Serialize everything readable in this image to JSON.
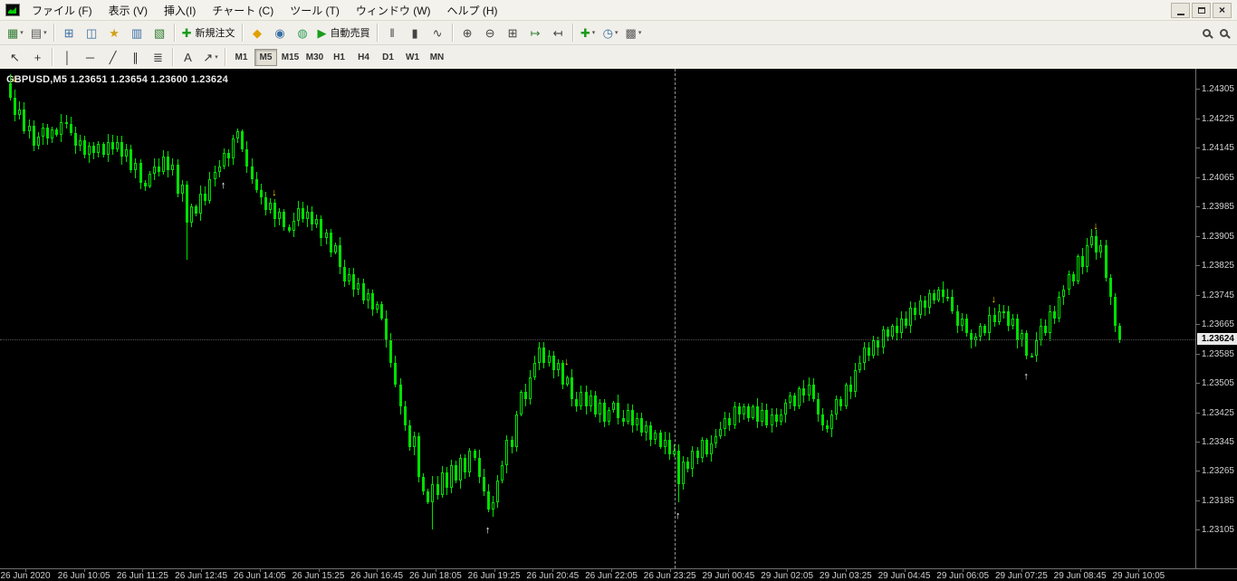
{
  "menu": {
    "items": [
      "ファイル (F)",
      "表示 (V)",
      "挿入(I)",
      "チャート (C)",
      "ツール (T)",
      "ウィンドウ (W)",
      "ヘルプ (H)"
    ],
    "item_names": [
      "file",
      "view",
      "insert",
      "charts",
      "tools",
      "window",
      "help"
    ]
  },
  "window": {
    "controls": [
      "minimize",
      "restore",
      "close"
    ]
  },
  "toolbar_main": {
    "items": [
      {
        "t": "btn",
        "name": "new-chart",
        "glyph": "▦",
        "color": "#2e7d32",
        "drop": true
      },
      {
        "t": "btn",
        "name": "profiles",
        "glyph": "▤",
        "color": "#5a5a5a",
        "drop": true
      },
      {
        "t": "sep"
      },
      {
        "t": "btn",
        "name": "market-watch",
        "glyph": "⊞",
        "color": "#3a6ea5"
      },
      {
        "t": "btn",
        "name": "data-window",
        "glyph": "◫",
        "color": "#3a6ea5"
      },
      {
        "t": "btn",
        "name": "navigator",
        "glyph": "★",
        "color": "#d4a017"
      },
      {
        "t": "btn",
        "name": "terminal",
        "glyph": "▥",
        "color": "#3a6ea5"
      },
      {
        "t": "btn",
        "name": "strategy-tester",
        "glyph": "▧",
        "color": "#2e7d32"
      },
      {
        "t": "sep"
      },
      {
        "t": "btn",
        "name": "new-order",
        "glyph": "✚",
        "color": "#1a9c1a",
        "label": "新規注文"
      },
      {
        "t": "sep"
      },
      {
        "t": "btn",
        "name": "metaeditor",
        "glyph": "◆",
        "color": "#e0a000"
      },
      {
        "t": "btn",
        "name": "experts",
        "glyph": "◉",
        "color": "#3a6ea5"
      },
      {
        "t": "btn",
        "name": "mql5-community",
        "glyph": "◍",
        "color": "#2e9e5b"
      },
      {
        "t": "btn",
        "name": "auto-trading",
        "glyph": "▶",
        "color": "#1a9c1a",
        "label": "自動売買"
      },
      {
        "t": "sep"
      },
      {
        "t": "btn",
        "name": "chart-bars",
        "glyph": "‖",
        "color": "#444"
      },
      {
        "t": "btn",
        "name": "chart-candlesticks",
        "glyph": "▮",
        "color": "#444"
      },
      {
        "t": "btn",
        "name": "chart-line",
        "glyph": "∿",
        "color": "#444"
      },
      {
        "t": "sep"
      },
      {
        "t": "btn",
        "name": "zoom-in",
        "glyph": "⊕",
        "color": "#444"
      },
      {
        "t": "btn",
        "name": "zoom-out",
        "glyph": "⊖",
        "color": "#444"
      },
      {
        "t": "btn",
        "name": "tile-windows",
        "glyph": "⊞",
        "color": "#444"
      },
      {
        "t": "btn",
        "name": "auto-scroll",
        "glyph": "↦",
        "color": "#2e7d32"
      },
      {
        "t": "btn",
        "name": "chart-shift",
        "glyph": "↤",
        "color": "#444"
      },
      {
        "t": "sep"
      },
      {
        "t": "btn",
        "name": "indicators",
        "glyph": "✚",
        "color": "#1a9c1a",
        "drop": true
      },
      {
        "t": "btn",
        "name": "periods",
        "glyph": "◷",
        "color": "#3a6ea5",
        "drop": true
      },
      {
        "t": "btn",
        "name": "templates",
        "glyph": "▩",
        "color": "#5a5a5a",
        "drop": true
      }
    ]
  },
  "toolbar_draw": {
    "items": [
      {
        "t": "btn",
        "name": "cursor",
        "glyph": "↖",
        "color": "#333"
      },
      {
        "t": "btn",
        "name": "crosshair",
        "glyph": "+",
        "color": "#333"
      },
      {
        "t": "sep"
      },
      {
        "t": "btn",
        "name": "vertical-line",
        "glyph": "│",
        "color": "#333"
      },
      {
        "t": "btn",
        "name": "horizontal-line",
        "glyph": "─",
        "color": "#333"
      },
      {
        "t": "btn",
        "name": "trendline",
        "glyph": "╱",
        "color": "#333"
      },
      {
        "t": "btn",
        "name": "equidistant-channel",
        "glyph": "∥",
        "color": "#333"
      },
      {
        "t": "btn",
        "name": "fibonacci-retracement",
        "glyph": "≣",
        "color": "#333"
      },
      {
        "t": "sep"
      },
      {
        "t": "btn",
        "name": "text-label",
        "glyph": "A",
        "color": "#333"
      },
      {
        "t": "btn",
        "name": "arrows-tool",
        "glyph": "↗",
        "color": "#333",
        "drop": true
      },
      {
        "t": "sep"
      }
    ]
  },
  "timeframes": {
    "items": [
      "M1",
      "M5",
      "M15",
      "M30",
      "H1",
      "H4",
      "D1",
      "W1",
      "MN"
    ],
    "active": "M5"
  },
  "chart_data": {
    "type": "candlestick",
    "symbol": "GBPUSD,M5",
    "ohlc_text": "1.23651 1.23654 1.23600 1.23624",
    "ylim": [
      1.23,
      1.2436
    ],
    "price_axis_labels": [
      "1.24305",
      "1.24225",
      "1.24145",
      "1.24065",
      "1.23985",
      "1.23905",
      "1.23825",
      "1.23745",
      "1.23665",
      "1.23585",
      "1.23505",
      "1.23425",
      "1.23345",
      "1.23265",
      "1.23185",
      "1.23105"
    ],
    "current_price": "1.23624",
    "time_axis_labels": [
      "26 Jun 2020",
      "26 Jun 10:05",
      "26 Jun 11:25",
      "26 Jun 12:45",
      "26 Jun 14:05",
      "26 Jun 15:25",
      "26 Jun 16:45",
      "26 Jun 18:05",
      "26 Jun 19:25",
      "26 Jun 20:45",
      "26 Jun 22:05",
      "26 Jun 23:25",
      "29 Jun 00:45",
      "29 Jun 02:05",
      "29 Jun 03:25",
      "29 Jun 04:45",
      "29 Jun 06:05",
      "29 Jun 07:25",
      "29 Jun 08:45",
      "29 Jun 10:05"
    ],
    "separator_bar": 143.5,
    "first_open": 1.2432,
    "closes": [
      1.2428,
      1.24235,
      1.2425,
      1.2419,
      1.24205,
      1.2415,
      1.24175,
      1.242,
      1.2417,
      1.24195,
      1.2418,
      1.24215,
      1.2421,
      1.24185,
      1.2415,
      1.24165,
      1.24125,
      1.2415,
      1.2413,
      1.24155,
      1.24125,
      1.2416,
      1.2414,
      1.2416,
      1.2412,
      1.2414,
      1.24085,
      1.24105,
      1.2405,
      1.2404,
      1.24075,
      1.24095,
      1.2408,
      1.2412,
      1.24085,
      1.241,
      1.2402,
      1.24045,
      1.2394,
      1.23985,
      1.23965,
      1.2402,
      1.24,
      1.2406,
      1.2408,
      1.24095,
      1.2413,
      1.24115,
      1.2417,
      1.2419,
      1.2414,
      1.24095,
      1.2406,
      1.2403,
      1.2401,
      1.23975,
      1.23995,
      1.2395,
      1.2397,
      1.2393,
      1.2392,
      1.23945,
      1.2398,
      1.2395,
      1.2397,
      1.23935,
      1.2395,
      1.239,
      1.23915,
      1.2386,
      1.2388,
      1.2382,
      1.2378,
      1.238,
      1.2376,
      1.23775,
      1.2373,
      1.2375,
      1.23705,
      1.2372,
      1.2368,
      1.2362,
      1.2356,
      1.235,
      1.2344,
      1.2339,
      1.2333,
      1.2336,
      1.2325,
      1.2321,
      1.2318,
      1.2323,
      1.232,
      1.2326,
      1.2322,
      1.2328,
      1.2324,
      1.233,
      1.2326,
      1.2332,
      1.233,
      1.2325,
      1.2321,
      1.2316,
      1.2318,
      1.2324,
      1.2328,
      1.2335,
      1.2333,
      1.2342,
      1.2348,
      1.2346,
      1.2352,
      1.2356,
      1.236,
      1.2356,
      1.2358,
      1.2354,
      1.2356,
      1.235,
      1.2352,
      1.2346,
      1.2344,
      1.2348,
      1.2344,
      1.2347,
      1.2342,
      1.2345,
      1.234,
      1.2343,
      1.2345,
      1.2341,
      1.234,
      1.2343,
      1.2339,
      1.2341,
      1.2337,
      1.2339,
      1.2335,
      1.2337,
      1.2333,
      1.2335,
      1.2331,
      1.2332,
      1.2323,
      1.2329,
      1.2327,
      1.2332,
      1.233,
      1.2335,
      1.2331,
      1.2334,
      1.2336,
      1.2338,
      1.2341,
      1.2339,
      1.2344,
      1.2342,
      1.2344,
      1.2341,
      1.2344,
      1.234,
      1.2343,
      1.2339,
      1.2342,
      1.234,
      1.2342,
      1.2345,
      1.2347,
      1.2344,
      1.2349,
      1.2347,
      1.235,
      1.2346,
      1.2342,
      1.2339,
      1.2338,
      1.2342,
      1.2346,
      1.2344,
      1.235,
      1.2348,
      1.2354,
      1.2356,
      1.236,
      1.2358,
      1.2362,
      1.236,
      1.2365,
      1.2363,
      1.2366,
      1.2364,
      1.2368,
      1.2366,
      1.2371,
      1.2369,
      1.2373,
      1.2371,
      1.2375,
      1.2373,
      1.2376,
      1.2374,
      1.2374,
      1.237,
      1.2366,
      1.2368,
      1.2364,
      1.2362,
      1.2363,
      1.2366,
      1.2364,
      1.2369,
      1.2367,
      1.237,
      1.237,
      1.2366,
      1.2368,
      1.2362,
      1.2364,
      1.2358,
      1.2358,
      1.2362,
      1.2366,
      1.2364,
      1.237,
      1.2368,
      1.2374,
      1.2376,
      1.238,
      1.2378,
      1.2385,
      1.2382,
      1.2388,
      1.23905,
      1.2386,
      1.2388,
      1.2379,
      1.2374,
      1.2366,
      1.23624
    ],
    "wick_overrides": {
      "0": {
        "high": 1.24345
      },
      "38": {
        "low": 1.2384
      },
      "91": {
        "low": 1.23105
      },
      "144": {
        "low": 1.2318
      }
    },
    "signals": [
      {
        "bar": 1,
        "price": 1.2433,
        "dir": "down"
      },
      {
        "bar": 46,
        "price": 1.2404,
        "dir": "up"
      },
      {
        "bar": 57,
        "price": 1.2402,
        "dir": "down"
      },
      {
        "bar": 103,
        "price": 1.231,
        "dir": "up"
      },
      {
        "bar": 120,
        "price": 1.2356,
        "dir": "down"
      },
      {
        "bar": 144,
        "price": 1.2314,
        "dir": "up"
      },
      {
        "bar": 212,
        "price": 1.2373,
        "dir": "down"
      },
      {
        "bar": 219,
        "price": 1.2352,
        "dir": "up"
      },
      {
        "bar": 234,
        "price": 1.2393,
        "dir": "down"
      }
    ],
    "colors": {
      "background": "#000000",
      "candle": "#00E000",
      "axis_text": "#CFCFCF",
      "arrow_up": "#FFFFFF",
      "arrow_down": "#FFD000"
    }
  }
}
